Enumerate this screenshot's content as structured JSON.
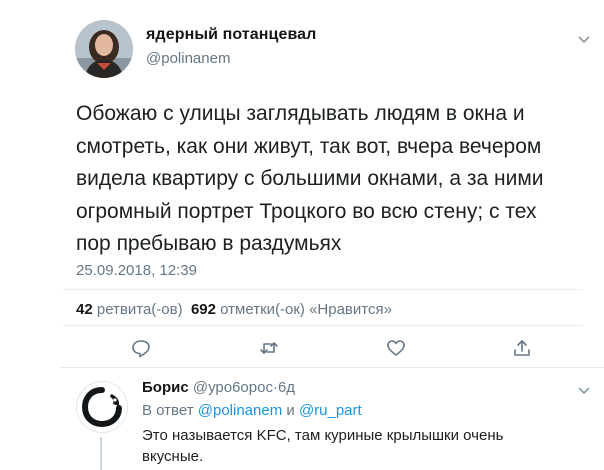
{
  "tweet": {
    "display_name": "ядерный потанцевал",
    "handle": "@polinanem",
    "text": "Обожаю с улицы заглядывать людям в окна и смотреть, как они живут, так вот, вчера вечером видела квартиру с большими окнами, а за ними огромный портрет Троцкого во всю стену; с тех пор пребываю в раздумьях",
    "timestamp": "25.09.2018, 12:39",
    "retweets_count": "42",
    "retweets_label": "ретвита(-ов)",
    "likes_count": "692",
    "likes_label": "отметки(-ок) «Нравится»"
  },
  "actions": [
    {
      "icon": "reply-icon"
    },
    {
      "icon": "retweet-icon"
    },
    {
      "icon": "like-icon"
    },
    {
      "icon": "share-icon"
    }
  ],
  "reply": {
    "display_name": "Борис",
    "handle": "@уро6орос",
    "separator": "·",
    "age": "6д",
    "in_reply_prefix": "В ответ",
    "mention1": "@polinanem",
    "conjunction": "и",
    "mention2": "@ru_part",
    "text": "Это называется KFC, там куриные крылышки очень вкусные."
  },
  "colors": {
    "text": "#14171a",
    "secondary": "#657786",
    "link": "#1b95e0",
    "divider": "#e6ecf0"
  }
}
